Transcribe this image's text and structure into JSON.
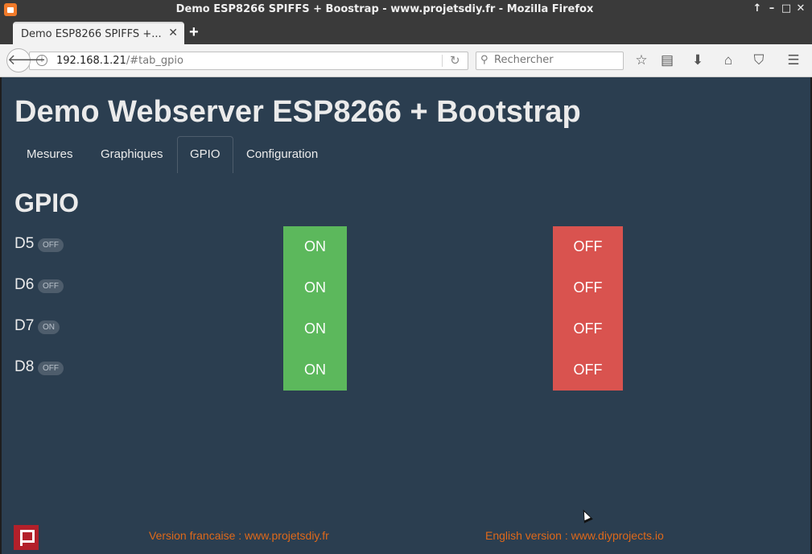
{
  "window": {
    "title": "Demo ESP8266 SPIFFS + Boostrap - www.projetsdiy.fr - Mozilla Firefox",
    "controls": [
      "↑",
      "–",
      "□",
      "✕"
    ]
  },
  "browser": {
    "tab_label": "Demo ESP8266 SPIFFS +...",
    "tab_close": "✕",
    "new_tab": "+",
    "url_host": "192.168.1.21",
    "url_path": "/#tab_gpio",
    "search_placeholder": "Rechercher",
    "toolbar_icons": [
      "bookmark-star-icon",
      "reading-list-icon",
      "download-icon",
      "home-icon",
      "pocket-icon",
      "hamburger-menu-icon"
    ]
  },
  "page": {
    "heading": "Demo Webserver ESP8266 + Bootstrap",
    "tabs": [
      {
        "label": "Mesures"
      },
      {
        "label": "Graphiques"
      },
      {
        "label": "GPIO",
        "active": true
      },
      {
        "label": "Configuration"
      }
    ],
    "section_title": "GPIO",
    "gpio": [
      {
        "name": "D5",
        "state": "OFF",
        "on_label": "ON",
        "off_label": "OFF"
      },
      {
        "name": "D6",
        "state": "OFF",
        "on_label": "ON",
        "off_label": "OFF"
      },
      {
        "name": "D7",
        "state": "ON",
        "on_label": "ON",
        "off_label": "OFF"
      },
      {
        "name": "D8",
        "state": "OFF",
        "on_label": "ON",
        "off_label": "OFF"
      }
    ]
  },
  "footer": {
    "french_link": "Version francaise : www.projetsdiy.fr",
    "english_link": "English version : www.diyprojects.io"
  },
  "colors": {
    "background": "#2b3e50",
    "on_button": "#5cb85c",
    "off_button": "#d9534f",
    "footer_link": "#df691a"
  }
}
